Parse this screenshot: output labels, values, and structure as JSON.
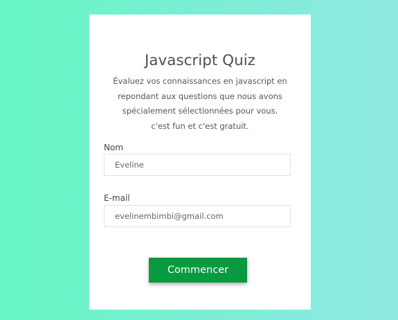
{
  "quiz": {
    "title": "Javascript Quiz",
    "description_lines": [
      "Évaluez vos connaissances en javascript en",
      "repondant aux questions que nous avons",
      "spécialement sélectionnées pour vous.",
      "c'est fun et c'est gratuit."
    ]
  },
  "form": {
    "name_label": "Nom",
    "name_value": "Eveline",
    "email_label": "E-mail",
    "email_value": "evelinembimbi@gmail.com",
    "start_label": "Commencer"
  },
  "colors": {
    "background_start": "#66f7c2",
    "background_end": "#8fe9e2",
    "button": "#089a3e"
  }
}
